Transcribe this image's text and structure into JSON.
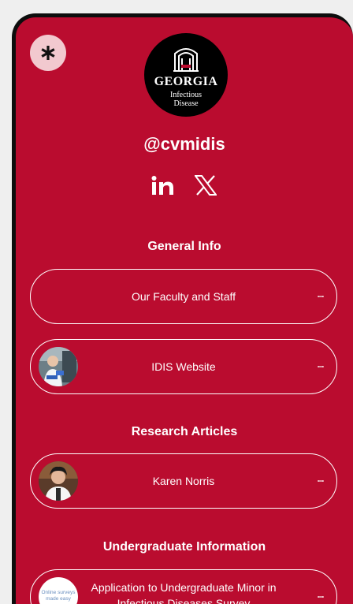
{
  "profile": {
    "handle": "@cvmidis",
    "logo": {
      "brand": "GEORGIA",
      "line1": "Infectious",
      "line2": "Disease"
    }
  },
  "icons": {
    "linktree": "asterisk-icon",
    "linkedin": "linkedin-icon",
    "x": "x-icon",
    "more": "more-vertical-icon"
  },
  "colors": {
    "background": "#ba0c2f",
    "text": "#ffffff",
    "frame": "#0d0d0d"
  },
  "sections": [
    {
      "title": "General Info",
      "links": [
        {
          "label": "Our Faculty and Staff"
        },
        {
          "label": "IDIS Website"
        }
      ]
    },
    {
      "title": "Research Articles",
      "links": [
        {
          "label": "Karen Norris"
        }
      ]
    },
    {
      "title": "Undergraduate Information",
      "links": [
        {
          "label": "Application to Undergraduate Minor in Infectious Diseases Survey",
          "thumb_text": "Online surveys made easy"
        }
      ]
    }
  ]
}
